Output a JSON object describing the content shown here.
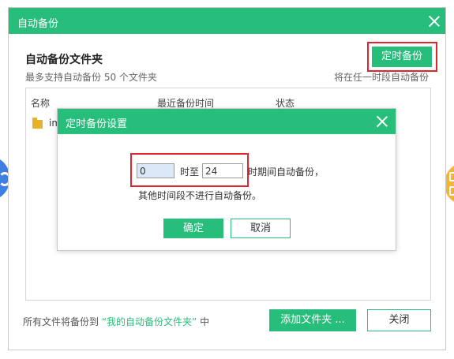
{
  "main": {
    "title": "自动备份",
    "section_title": "自动备份文件夹",
    "subtitle": "最多支持自动备份 50 个文件夹",
    "hint_right": "将在任一时段自动备份",
    "scheduled_button": "定时备份",
    "columns": [
      "名称",
      "最近备份时间",
      "状态"
    ],
    "row": {
      "name": "im"
    },
    "footer_prefix": "所有文件将备份到",
    "footer_link": "“我的自动备份文件夹”",
    "footer_suffix": "中",
    "add_folder_button": "添加文件夹 ...",
    "close_button": "关闭"
  },
  "schedule_dialog": {
    "title": "定时备份设置",
    "start_hour": "0",
    "label_to": "时至",
    "end_hour": "24",
    "label_period": "时期间自动备份，",
    "note": "其他时间段不进行自动备份。",
    "ok_button": "确定",
    "cancel_button": "取消"
  },
  "colors": {
    "accent": "#27be7c",
    "highlight": "#e0262c"
  }
}
